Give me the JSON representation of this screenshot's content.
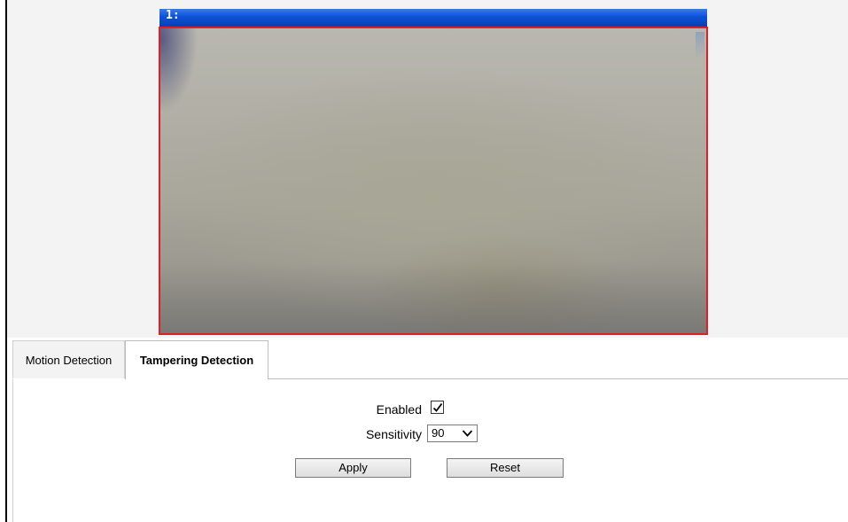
{
  "video": {
    "channel_label": "1:",
    "header_color": "#0b52d8",
    "border_color": "#e01e25"
  },
  "tabs": [
    {
      "label": "Motion Detection",
      "active": false
    },
    {
      "label": "Tampering Detection",
      "active": true
    }
  ],
  "form": {
    "enabled_label": "Enabled",
    "enabled_checked": true,
    "sensitivity_label": "Sensitivity",
    "sensitivity_value": "90",
    "apply_label": "Apply",
    "reset_label": "Reset"
  },
  "icons": {
    "checkmark": "check-icon",
    "dropdown": "chevron-down-icon"
  }
}
